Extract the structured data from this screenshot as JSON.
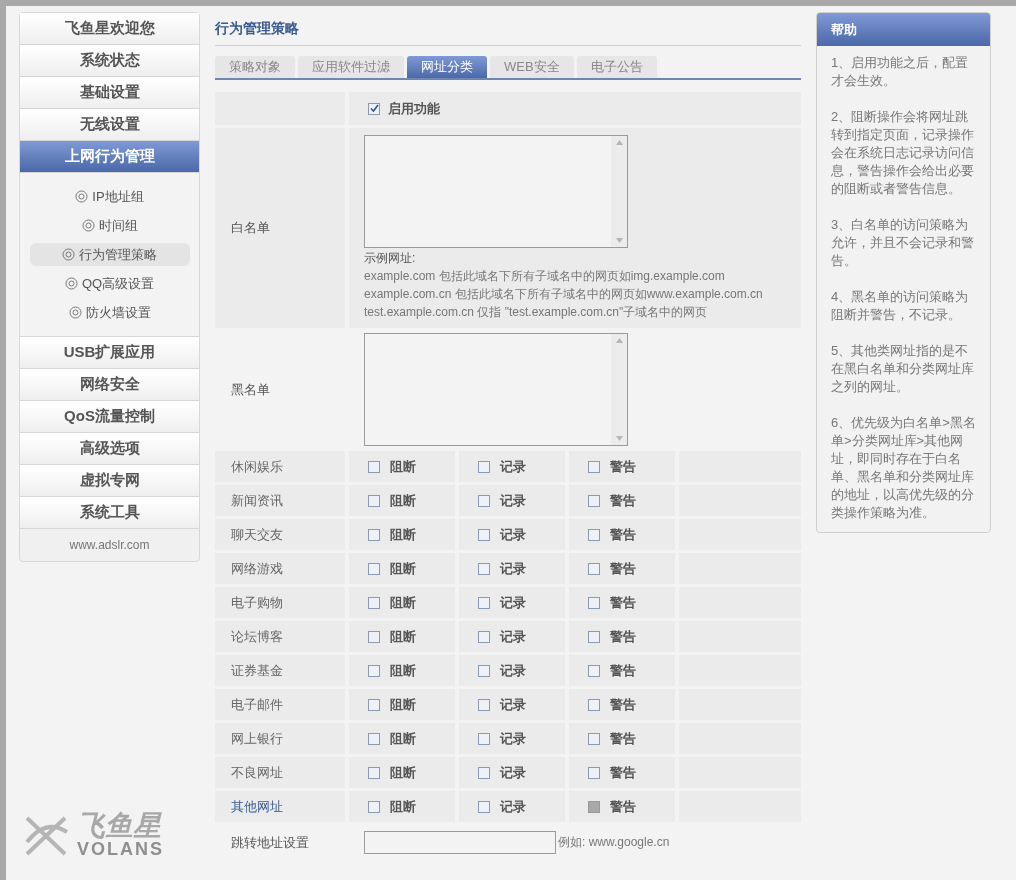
{
  "sidebar": {
    "items": [
      {
        "label": "飞鱼星欢迎您",
        "selected": false
      },
      {
        "label": "系统状态",
        "selected": false
      },
      {
        "label": "基础设置",
        "selected": false
      },
      {
        "label": "无线设置",
        "selected": false
      },
      {
        "label": "上网行为管理",
        "selected": true,
        "children": [
          {
            "label": "IP地址组",
            "selected": false
          },
          {
            "label": "时间组",
            "selected": false
          },
          {
            "label": "行为管理策略",
            "selected": true
          },
          {
            "label": "QQ高级设置",
            "selected": false
          },
          {
            "label": "防火墙设置",
            "selected": false
          }
        ]
      },
      {
        "label": "USB扩展应用",
        "selected": false
      },
      {
        "label": "网络安全",
        "selected": false
      },
      {
        "label": "QoS流量控制",
        "selected": false
      },
      {
        "label": "高级选项",
        "selected": false
      },
      {
        "label": "虚拟专网",
        "selected": false
      },
      {
        "label": "系统工具",
        "selected": false
      }
    ],
    "footer": "www.adslr.com"
  },
  "logo": {
    "name": "飞鱼星",
    "subtitle": "VOLANS"
  },
  "page_title": "行为管理策略",
  "tabs": [
    {
      "label": "策略对象",
      "selected": false
    },
    {
      "label": "应用软件过滤",
      "selected": false
    },
    {
      "label": "网址分类",
      "selected": true
    },
    {
      "label": "WEB安全",
      "selected": false
    },
    {
      "label": "电子公告",
      "selected": false
    }
  ],
  "enable": {
    "label": "启用功能",
    "checked": true
  },
  "whitelist": {
    "label": "白名单",
    "hint_title": "示例网址:",
    "hints": [
      "example.com 包括此域名下所有子域名中的网页如img.example.com",
      "example.com.cn 包括此域名下所有子域名中的网页如www.example.com.cn",
      "test.example.com.cn 仅指 \"test.example.com.cn\"子域名中的网页"
    ]
  },
  "blacklist": {
    "label": "黑名单"
  },
  "categories": [
    {
      "name": "休闲娱乐",
      "highlighted": false,
      "actions": [
        {
          "label": "阻断",
          "checked": false,
          "disabled": false
        },
        {
          "label": "记录",
          "checked": false,
          "disabled": false
        },
        {
          "label": "警告",
          "checked": false,
          "disabled": false
        }
      ]
    },
    {
      "name": "新闻资讯",
      "highlighted": false,
      "actions": [
        {
          "label": "阻断",
          "checked": false,
          "disabled": false
        },
        {
          "label": "记录",
          "checked": false,
          "disabled": false
        },
        {
          "label": "警告",
          "checked": false,
          "disabled": false
        }
      ]
    },
    {
      "name": "聊天交友",
      "highlighted": false,
      "actions": [
        {
          "label": "阻断",
          "checked": false,
          "disabled": false
        },
        {
          "label": "记录",
          "checked": false,
          "disabled": false
        },
        {
          "label": "警告",
          "checked": false,
          "disabled": false
        }
      ]
    },
    {
      "name": "网络游戏",
      "highlighted": false,
      "actions": [
        {
          "label": "阻断",
          "checked": false,
          "disabled": false
        },
        {
          "label": "记录",
          "checked": false,
          "disabled": false
        },
        {
          "label": "警告",
          "checked": false,
          "disabled": false
        }
      ]
    },
    {
      "name": "电子购物",
      "highlighted": false,
      "actions": [
        {
          "label": "阻断",
          "checked": false,
          "disabled": false
        },
        {
          "label": "记录",
          "checked": false,
          "disabled": false
        },
        {
          "label": "警告",
          "checked": false,
          "disabled": false
        }
      ]
    },
    {
      "name": "论坛博客",
      "highlighted": false,
      "actions": [
        {
          "label": "阻断",
          "checked": false,
          "disabled": false
        },
        {
          "label": "记录",
          "checked": false,
          "disabled": false
        },
        {
          "label": "警告",
          "checked": false,
          "disabled": false
        }
      ]
    },
    {
      "name": "证券基金",
      "highlighted": false,
      "actions": [
        {
          "label": "阻断",
          "checked": false,
          "disabled": false
        },
        {
          "label": "记录",
          "checked": false,
          "disabled": false
        },
        {
          "label": "警告",
          "checked": false,
          "disabled": false
        }
      ]
    },
    {
      "name": "电子邮件",
      "highlighted": false,
      "actions": [
        {
          "label": "阻断",
          "checked": false,
          "disabled": false
        },
        {
          "label": "记录",
          "checked": false,
          "disabled": false
        },
        {
          "label": "警告",
          "checked": false,
          "disabled": false
        }
      ]
    },
    {
      "name": "网上银行",
      "highlighted": false,
      "actions": [
        {
          "label": "阻断",
          "checked": false,
          "disabled": false
        },
        {
          "label": "记录",
          "checked": false,
          "disabled": false
        },
        {
          "label": "警告",
          "checked": false,
          "disabled": false
        }
      ]
    },
    {
      "name": "不良网址",
      "highlighted": false,
      "actions": [
        {
          "label": "阻断",
          "checked": false,
          "disabled": false
        },
        {
          "label": "记录",
          "checked": false,
          "disabled": false
        },
        {
          "label": "警告",
          "checked": false,
          "disabled": false
        }
      ]
    },
    {
      "name": "其他网址",
      "highlighted": true,
      "actions": [
        {
          "label": "阻断",
          "checked": false,
          "disabled": false
        },
        {
          "label": "记录",
          "checked": false,
          "disabled": false
        },
        {
          "label": "警告",
          "checked": false,
          "disabled": true
        }
      ]
    }
  ],
  "redirect": {
    "label": "跳转地址设置",
    "example": "例如: www.google.cn"
  },
  "help": {
    "title": "帮助",
    "items": [
      "1、启用功能之后，配置才会生效。",
      "2、阻断操作会将网址跳转到指定页面，记录操作会在系统日志记录访问信息，警告操作会给出必要的阻断或者警告信息。",
      "3、白名单的访问策略为允许，并且不会记录和警告。",
      "4、黑名单的访问策略为阻断并警告，不记录。",
      "5、其他类网址指的是不在黑白名单和分类网址库之列的网址。",
      "6、优先级为白名单>黑名单>分类网址库>其他网址，即同时存在于白名单、黑名单和分类网址库的地址，以高优先级的分类操作策略为准。"
    ]
  }
}
